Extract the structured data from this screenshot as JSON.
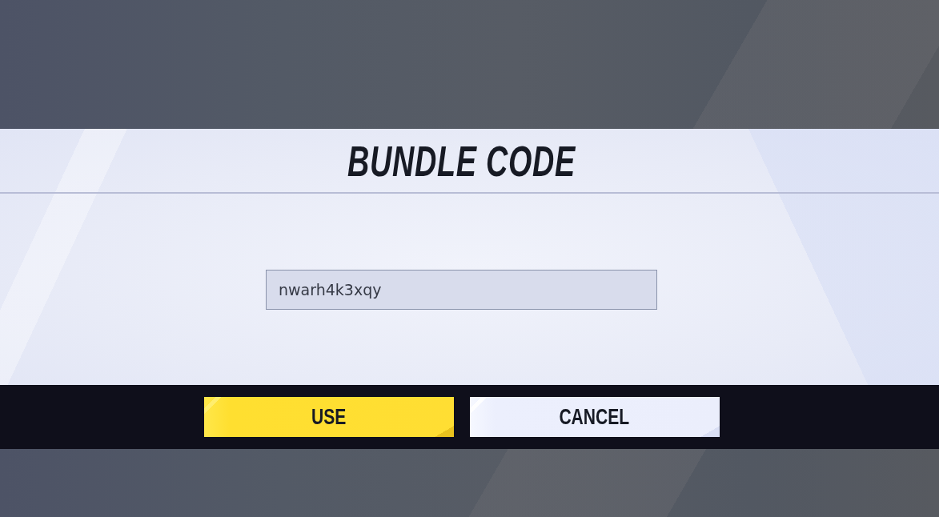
{
  "dialog": {
    "title": "BUNDLE CODE",
    "code_field": {
      "value": "nwarh4k3xqy"
    },
    "buttons": [
      {
        "label": "USE",
        "kind": "primary"
      },
      {
        "label": "CANCEL",
        "kind": "secondary"
      }
    ]
  }
}
